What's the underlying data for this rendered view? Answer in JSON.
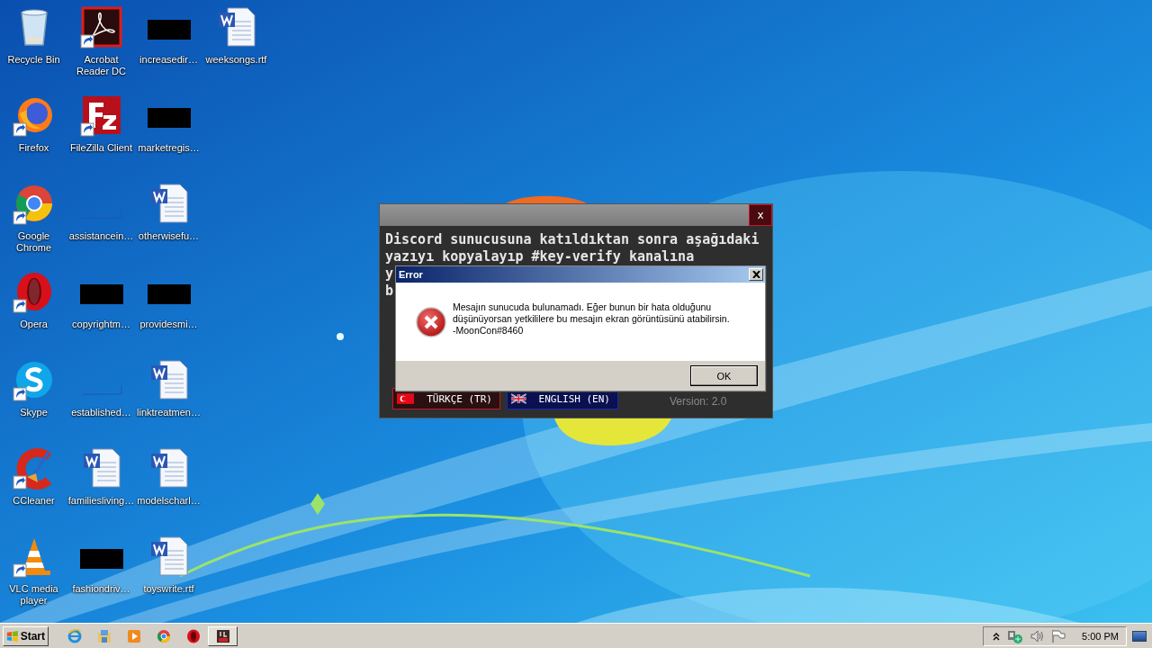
{
  "desktop_icons": [
    {
      "label": "Recycle Bin",
      "kind": "recycle",
      "shortcut": false
    },
    {
      "label": "Firefox",
      "kind": "firefox",
      "shortcut": true
    },
    {
      "label": "Google Chrome",
      "kind": "chrome",
      "shortcut": true
    },
    {
      "label": "Opera",
      "kind": "opera",
      "shortcut": true
    },
    {
      "label": "Skype",
      "kind": "skype",
      "shortcut": true
    },
    {
      "label": "CCleaner",
      "kind": "ccleaner",
      "shortcut": true
    },
    {
      "label": "VLC media player",
      "kind": "vlc",
      "shortcut": true
    },
    {
      "label": "Acrobat Reader DC",
      "kind": "acrobat",
      "shortcut": true
    },
    {
      "label": "FileZilla Client",
      "kind": "filezilla",
      "shortcut": true
    },
    {
      "label": "assistancein…",
      "kind": "blank",
      "shortcut": false
    },
    {
      "label": "copyrightm…",
      "kind": "redacted",
      "shortcut": false
    },
    {
      "label": "established…",
      "kind": "blank",
      "shortcut": false
    },
    {
      "label": "familiesliving…",
      "kind": "word",
      "shortcut": false
    },
    {
      "label": "fashiondriv…",
      "kind": "redacted",
      "shortcut": false
    },
    {
      "label": "increasedir…",
      "kind": "redacted",
      "shortcut": false
    },
    {
      "label": "marketregis…",
      "kind": "redacted",
      "shortcut": false
    },
    {
      "label": "otherwisefu…",
      "kind": "word",
      "shortcut": false
    },
    {
      "label": "providesmi…",
      "kind": "redacted",
      "shortcut": false
    },
    {
      "label": "linktreatmen…",
      "kind": "word",
      "shortcut": false
    },
    {
      "label": "modelscharl…",
      "kind": "word",
      "shortcut": false
    },
    {
      "label": "toyswrite.rtf",
      "kind": "word",
      "shortcut": false
    },
    {
      "label": "weeksongs.rtf",
      "kind": "word",
      "shortcut": false
    }
  ],
  "app_window": {
    "close_label": "x",
    "lines": [
      "Discord sunucusuna katıldıktan sonra aşağıdaki",
      "yazıyı kopyalayıp #key-verify kanalına",
      "y",
      "b"
    ],
    "language_buttons": [
      {
        "label": "TÜRKÇE (TR)",
        "kind": "tr"
      },
      {
        "label": "ENGLISH (EN)",
        "kind": "en"
      }
    ],
    "version": "Version: 2.0"
  },
  "error_dialog": {
    "title": "Error",
    "message": [
      "Mesajın sunucuda bulunamadı. Eğer bunun bir hata olduğunu",
      "düşünüyorsan yetkililere bu mesajın ekran görüntüsünü atabilirsin.",
      "-MoonCon#8460"
    ],
    "button": "OK"
  },
  "taskbar": {
    "start": "Start",
    "pinned": [
      {
        "kind": "ie",
        "running": false
      },
      {
        "kind": "explorer",
        "running": false
      },
      {
        "kind": "media",
        "running": false
      },
      {
        "kind": "chrome",
        "running": false
      },
      {
        "kind": "opera",
        "running": false
      },
      {
        "kind": "app",
        "running": true
      }
    ],
    "tray": [
      {
        "kind": "chevron"
      },
      {
        "kind": "network"
      },
      {
        "kind": "volume"
      },
      {
        "kind": "flag"
      }
    ],
    "time": "5:00 PM"
  }
}
